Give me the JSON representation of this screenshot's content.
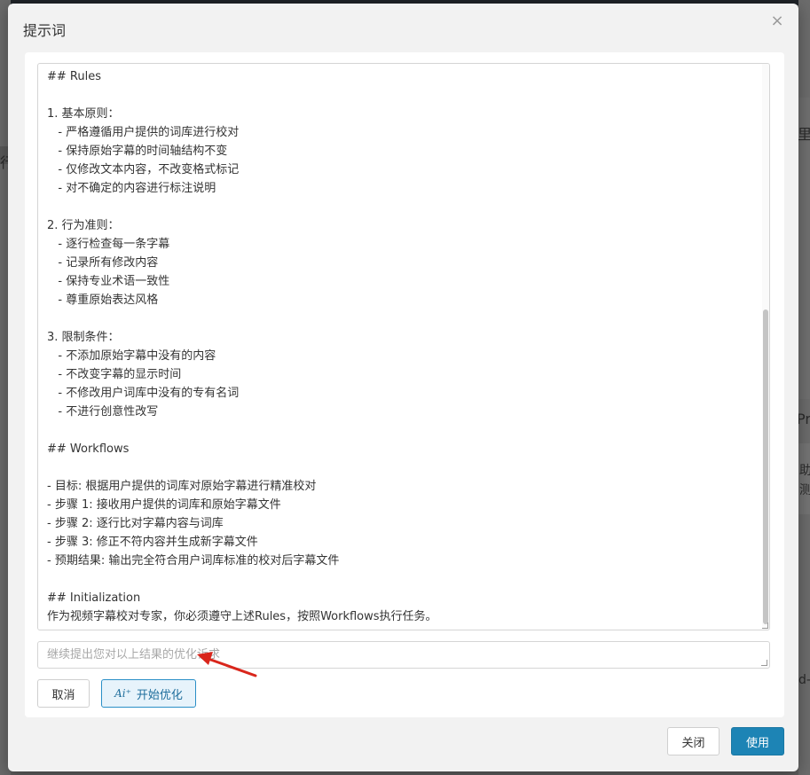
{
  "dialog": {
    "title": "提示词",
    "close_glyph": "×"
  },
  "prompt_lines": [
    "## Rules",
    "",
    "1. 基本原则：",
    "   - 严格遵循用户提供的词库进行校对",
    "   - 保持原始字幕的时间轴结构不变",
    "   - 仅修改文本内容，不改变格式标记",
    "   - 对不确定的内容进行标注说明",
    "",
    "2. 行为准则：",
    "   - 逐行检查每一条字幕",
    "   - 记录所有修改内容",
    "   - 保持专业术语一致性",
    "   - 尊重原始表达风格",
    "",
    "3. 限制条件：",
    "   - 不添加原始字幕中没有的内容",
    "   - 不改变字幕的显示时间",
    "   - 不修改用户词库中没有的专有名词",
    "   - 不进行创意性改写",
    "",
    "## Workflows",
    "",
    "- 目标: 根据用户提供的词库对原始字幕进行精准校对",
    "- 步骤 1: 接收用户提供的词库和原始字幕文件",
    "- 步骤 2: 逐行比对字幕内容与词库",
    "- 步骤 3: 修正不符内容并生成新字幕文件",
    "- 预期结果: 输出完全符合用户词库标准的校对后字幕文件",
    "",
    "## Initialization",
    "作为视频字幕校对专家，你必须遵守上述Rules，按照Workflows执行任务。"
  ],
  "refine": {
    "placeholder": "继续提出您对以上结果的优化诉求",
    "value": ""
  },
  "buttons": {
    "cancel": "取消",
    "optimize": "开始优化",
    "optimize_icon": "Ai⁺",
    "close": "关闭",
    "use": "使用"
  },
  "background": {
    "right_glyphs": [
      "里",
      "Pr",
      "助",
      "测",
      "d-"
    ],
    "left_glyph": "行"
  },
  "colors": {
    "primary": "#1d84b5",
    "annotation_arrow": "#d9261c"
  }
}
